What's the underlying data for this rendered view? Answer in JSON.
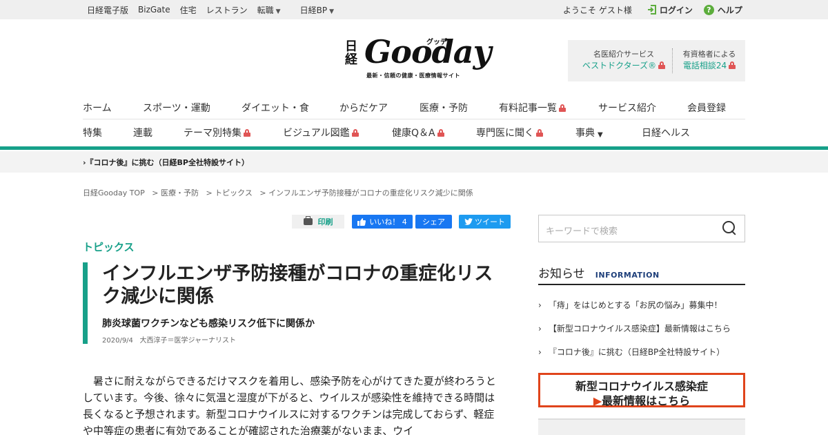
{
  "topbar": {
    "links": [
      "日経電子版",
      "BizGate",
      "住宅",
      "レストラン",
      "転職",
      "日経BP"
    ],
    "welcome": "ようこそ ゲスト様",
    "login": "ログイン",
    "help": "ヘルプ"
  },
  "logo": {
    "nikkei": "日経",
    "name": "Gooday",
    "kana": "グッデイ",
    "tagline": "最新・信頼の健康・医療情報サイト"
  },
  "services": {
    "col1_label": "名医紹介サービス",
    "col1_link": "ベストドクターズ®",
    "col2_label": "有資格者による",
    "col2_link": "電話相談24"
  },
  "nav1": [
    "ホーム",
    "スポーツ・運動",
    "ダイエット・食",
    "からだケア",
    "医療・予防",
    "有料記事一覧",
    "サービス紹介",
    "会員登録"
  ],
  "nav2": [
    "特集",
    "連載",
    "テーマ別特集",
    "ビジュアル図鑑",
    "健康Q＆A",
    "専門医に聞く",
    "事典",
    "日経ヘルス"
  ],
  "subbar": "『コロナ後』に挑む（日経BP全社特設サイト）",
  "breadcrumb": [
    "日経Gooday TOP",
    "医療・予防",
    "トピックス",
    "インフルエンザ予防接種がコロナの重症化リスク減少に関係"
  ],
  "share": {
    "print": "印刷",
    "like": "いいね！ 4",
    "share": "シェア",
    "tweet": "ツイート"
  },
  "article": {
    "category": "トピックス",
    "title": "インフルエンザ予防接種がコロナの重症化リスク減少に関係",
    "subtitle": "肺炎球菌ワクチンなども感染リスク低下に関係か",
    "date": "2020/9/4",
    "author": "大西淳子＝医学ジャーナリスト",
    "body": "暑さに耐えながらできるだけマスクを着用し、感染予防を心がけてきた夏が終わろうとしています。今後、徐々に気温と湿度が下がると、ウイルスが感染性を維持できる時間は長くなると予想されます。新型コロナウイルスに対するワクチンは完成しておらず、軽症や中等症の患者に有効であることが確認された治療薬がないまま、ウイ"
  },
  "sidebar": {
    "search_placeholder": "キーワードで検索",
    "info_title": "お知らせ",
    "info_en": "INFORMATION",
    "info_items": [
      "「痔」をはじめとする「お尻の悩み」募集中！",
      "【新型コロナウイルス感染症】最新情報はこちら",
      "『コロナ後』に挑む（日経BP全社特設サイト）"
    ],
    "banner_line1": "新型コロナウイルス感染症",
    "banner_line2": "最新情報はこちら"
  },
  "colors": {
    "accent": "#17a089",
    "banner_border": "#e0441b",
    "facebook": "#1877f2",
    "twitter": "#1d9bf0"
  },
  "icons": [
    "login-icon",
    "help-icon",
    "lock-icon",
    "print-icon",
    "thumbs-up-icon",
    "twitter-bird-icon",
    "search-icon",
    "chevron-right-icon",
    "triangle-down-icon"
  ]
}
